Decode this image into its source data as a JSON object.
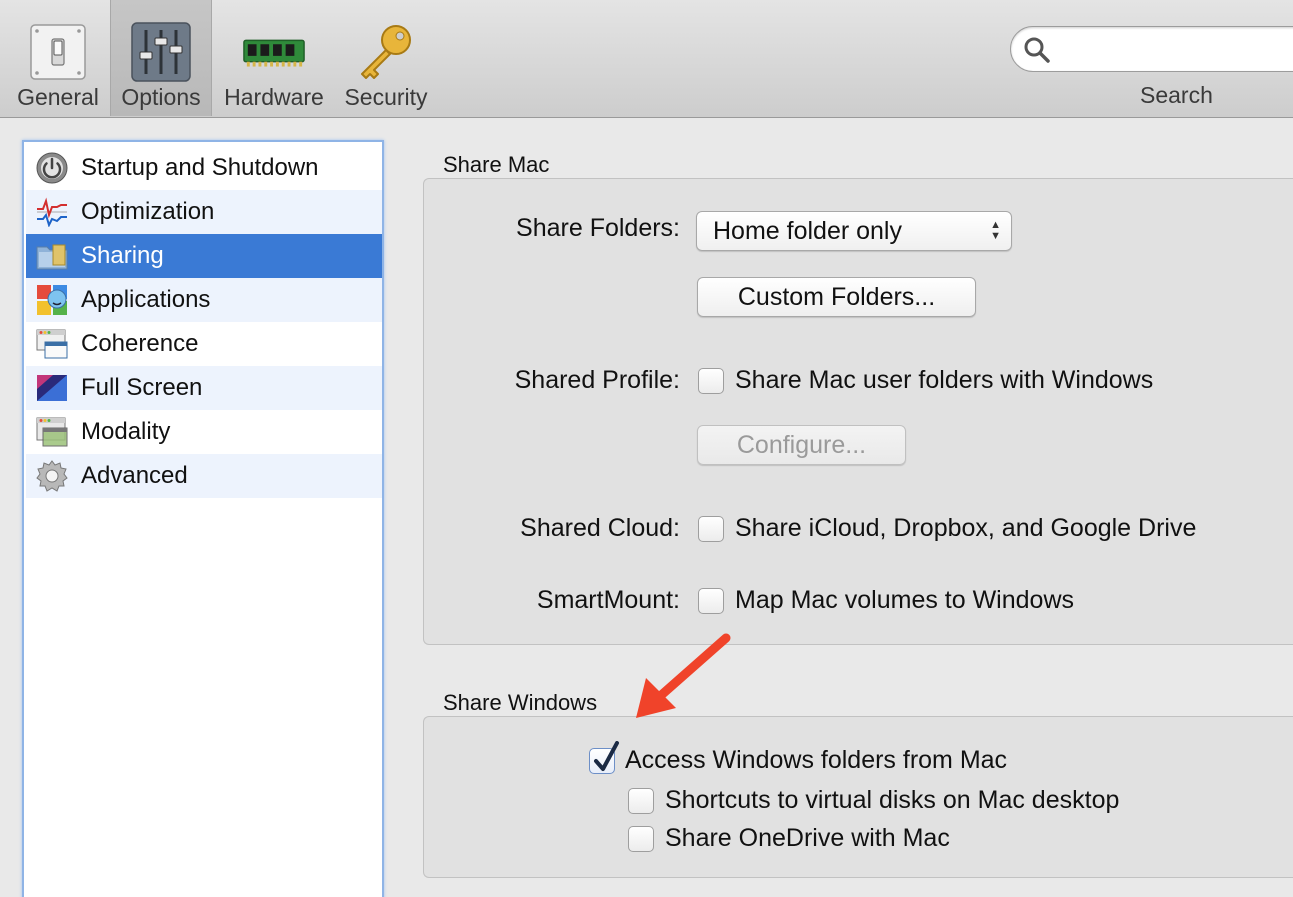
{
  "toolbar": {
    "items": [
      {
        "label": "General",
        "icon": "switch-icon"
      },
      {
        "label": "Options",
        "icon": "sliders-icon",
        "selected": true
      },
      {
        "label": "Hardware",
        "icon": "memory-chip-icon"
      },
      {
        "label": "Security",
        "icon": "key-icon"
      }
    ],
    "search": {
      "placeholder": "",
      "label": "Search"
    }
  },
  "sidebar": {
    "items": [
      {
        "label": "Startup and Shutdown",
        "icon": "power-icon"
      },
      {
        "label": "Optimization",
        "icon": "performance-graph-icon"
      },
      {
        "label": "Sharing",
        "icon": "shared-folder-icon",
        "selected": true
      },
      {
        "label": "Applications",
        "icon": "applications-icon"
      },
      {
        "label": "Coherence",
        "icon": "coherence-icon"
      },
      {
        "label": "Full Screen",
        "icon": "full-screen-icon"
      },
      {
        "label": "Modality",
        "icon": "modality-icon"
      },
      {
        "label": "Advanced",
        "icon": "gear-icon"
      }
    ]
  },
  "share_mac": {
    "title": "Share Mac",
    "share_folders_label": "Share Folders:",
    "share_folders_value": "Home folder only",
    "custom_folders_button": "Custom Folders...",
    "shared_profile_label": "Shared Profile:",
    "shared_profile_checkbox": "Share Mac user folders with Windows",
    "shared_profile_checked": false,
    "configure_button": "Configure...",
    "shared_cloud_label": "Shared Cloud:",
    "shared_cloud_checkbox": "Share iCloud, Dropbox, and Google Drive",
    "shared_cloud_checked": false,
    "smartmount_label": "SmartMount:",
    "smartmount_checkbox": "Map Mac volumes to Windows",
    "smartmount_checked": false
  },
  "share_windows": {
    "title": "Share Windows",
    "access_checkbox": "Access Windows folders from Mac",
    "access_checked": true,
    "shortcuts_checkbox": "Shortcuts to virtual disks on Mac desktop",
    "shortcuts_checked": false,
    "onedrive_checkbox": "Share OneDrive with Mac",
    "onedrive_checked": false
  },
  "colors": {
    "selection": "#3a7ad5",
    "annotation_arrow": "#f0432a"
  }
}
